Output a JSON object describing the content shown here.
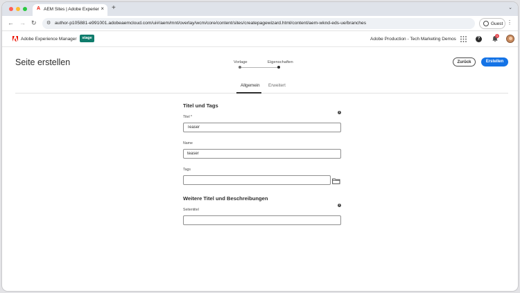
{
  "browser": {
    "tab_title": "AEM Sites | Adobe Experience",
    "tab_favicon_glyph": "A",
    "tab_close": "×",
    "new_tab": "+",
    "url": "author-p105881-e991001.adobeaemcloud.com/ui#/aem/mnt/overlay/wcm/core/content/sites/createpagewizard.html/content/aem-wknd-eds-ue/branches",
    "profile_label": "Guest"
  },
  "shell": {
    "app_name": "Adobe Experience Manager",
    "environment_badge": "stage",
    "organization": "Adobe Production - Tech Marketing Demos",
    "notification_count": "1",
    "help_glyph": "?"
  },
  "wizard": {
    "title": "Seite erstellen",
    "steps": [
      {
        "label": "Vorlage",
        "state": "done"
      },
      {
        "label": "Eigenschaften",
        "state": "current"
      }
    ],
    "back_label": "Zurück",
    "create_label": "Erstellen"
  },
  "tabs": [
    {
      "label": "Allgemein",
      "active": true
    },
    {
      "label": "Erweitert",
      "active": false
    }
  ],
  "form": {
    "section1_title": "Titel und Tags",
    "title_label": "Titel *",
    "title_value": "Teaser",
    "name_label": "Name",
    "name_value": "teaser",
    "tags_label": "Tags",
    "tags_value": "",
    "section2_title": "Weitere Titel und Beschreibungen",
    "page_title_label": "Seitentitel",
    "page_title_value": "",
    "info_glyph": "i"
  },
  "colors": {
    "accent": "#1473e6",
    "env_badge": "#0f7c6c",
    "adobe_red": "#eb1000",
    "notification": "#e34850"
  },
  "icons": [
    "back-arrow-icon",
    "forward-arrow-icon",
    "reload-icon",
    "site-settings-icon",
    "profile-icon",
    "apps-grid-icon",
    "help-icon",
    "bell-icon",
    "avatar",
    "info-icon",
    "folder-icon"
  ]
}
